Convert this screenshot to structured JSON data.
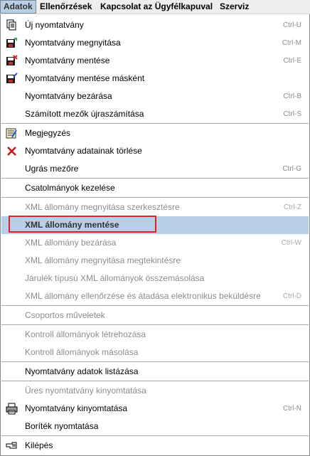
{
  "menubar": {
    "items": [
      "Adatok",
      "Ellenőrzések",
      "Kapcsolat az Ügyfélkapuval",
      "Szerviz"
    ]
  },
  "menu": {
    "items": [
      {
        "label": "Új nyomtatvány",
        "shortcut": "Ctrl-U",
        "icon": "new-document-icon"
      },
      {
        "label": "Nyomtatvány megnyitása",
        "shortcut": "Ctrl-M",
        "icon": "open-floppy-icon"
      },
      {
        "label": "Nyomtatvány mentése",
        "shortcut": "Ctrl-E",
        "icon": "save-floppy-icon"
      },
      {
        "label": "Nyomtatvány mentése másként",
        "shortcut": "",
        "icon": "save-as-floppy-icon"
      },
      {
        "label": "Nyomtatvány bezárása",
        "shortcut": "Ctrl-B"
      },
      {
        "label": "Számított mezők újraszámítása",
        "shortcut": "Ctrl-S"
      },
      {
        "label": "Megjegyzés",
        "shortcut": "",
        "icon": "note-icon"
      },
      {
        "label": "Nyomtatvány adatainak törlése",
        "shortcut": "",
        "icon": "delete-x-icon"
      },
      {
        "label": "Ugrás mezőre",
        "shortcut": "Ctrl-G"
      },
      {
        "label": "Csatolmányok kezelése",
        "shortcut": ""
      },
      {
        "label": "XML állomány megnyitása szerkesztésre",
        "shortcut": "Ctrl-Z"
      },
      {
        "label": "XML állomány mentése",
        "shortcut": ""
      },
      {
        "label": "XML állomány bezárása",
        "shortcut": "Ctrl-W"
      },
      {
        "label": "XML állomány megnyitása megtekintésre",
        "shortcut": ""
      },
      {
        "label": "Járulék típusú XML állományok összemásolása",
        "shortcut": ""
      },
      {
        "label": "XML állomány ellenőrzése és átadása elektronikus beküldésre",
        "shortcut": "Ctrl-D"
      },
      {
        "label": "Csoportos műveletek",
        "shortcut": ""
      },
      {
        "label": "Kontroll állományok létrehozása",
        "shortcut": ""
      },
      {
        "label": "Kontroll állományok másolása",
        "shortcut": ""
      },
      {
        "label": "Nyomtatvány adatok listázása",
        "shortcut": ""
      },
      {
        "label": "Üres nyomtatvány kinyomtatása",
        "shortcut": ""
      },
      {
        "label": "Nyomtatvány kinyomtatása",
        "shortcut": "Ctrl-N",
        "icon": "printer-icon"
      },
      {
        "label": "Boríték nyomtatása",
        "shortcut": ""
      },
      {
        "label": "Kilépés",
        "shortcut": "",
        "icon": "exit-hand-icon"
      }
    ]
  }
}
